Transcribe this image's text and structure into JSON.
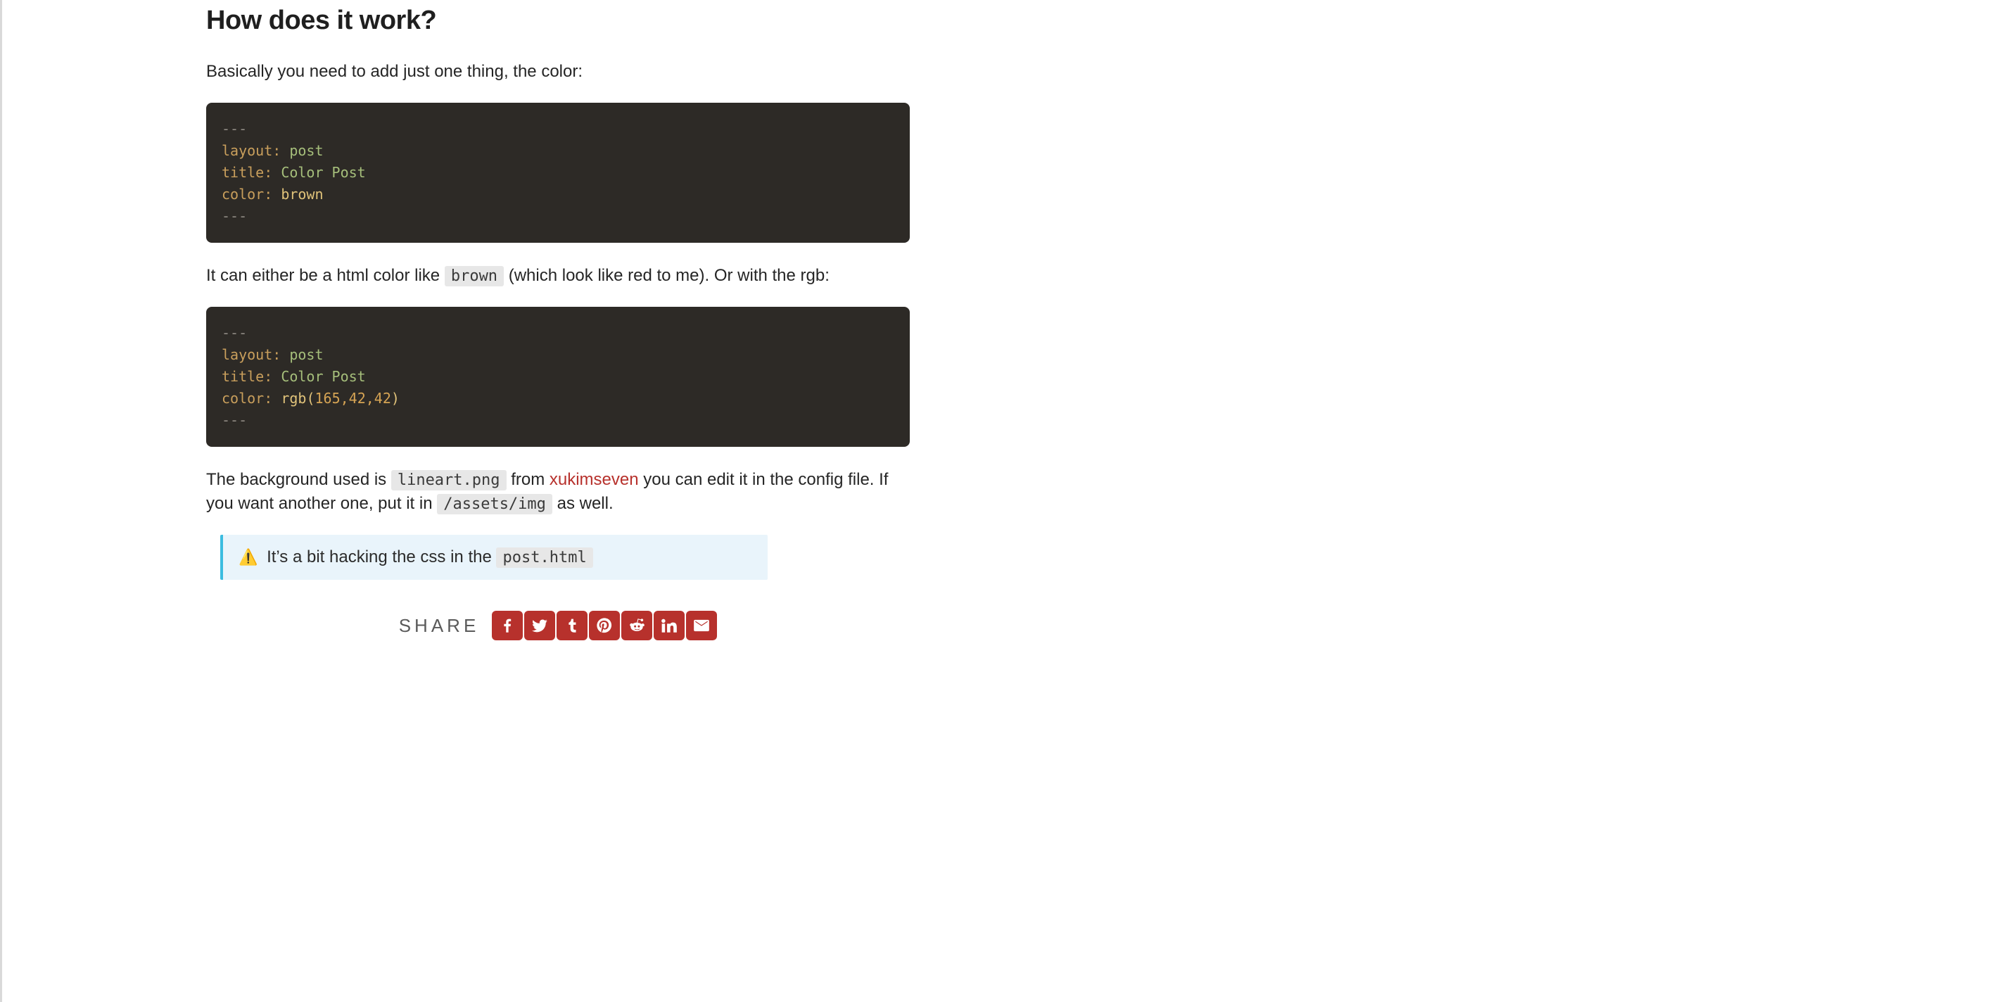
{
  "heading": "How does it work?",
  "p1": "Basically you need to add just one thing, the color:",
  "code1": {
    "sep": "---",
    "k1": "layout",
    "v1": "post",
    "k2": "title",
    "v2": "Color Post",
    "k3": "color",
    "v3": "brown"
  },
  "p2_a": "It can either be a html color like ",
  "p2_code": "brown",
  "p2_b": " (which look like red to me). Or with the rgb:",
  "code2": {
    "sep": "---",
    "k1": "layout",
    "v1": "post",
    "k2": "title",
    "v2": "Color Post",
    "k3": "color",
    "fn": "rgb",
    "args": "165,42,42"
  },
  "p3_a": "The background used is ",
  "p3_code1": "lineart.png",
  "p3_b": " from ",
  "p3_link": "xukimseven",
  "p3_c": " you can edit it in the config file. If you want another one, put it in ",
  "p3_code2": "/assets/img",
  "p3_d": " as well.",
  "callout_icon": "⚠️",
  "callout_a": " It’s a bit hacking the css in the ",
  "callout_code": "post.html",
  "share_label": "SHARE",
  "share": {
    "facebook": "facebook-icon",
    "twitter": "twitter-icon",
    "tumblr": "tumblr-icon",
    "pinterest": "pinterest-icon",
    "reddit": "reddit-icon",
    "linkedin": "linkedin-icon",
    "email": "email-icon"
  }
}
